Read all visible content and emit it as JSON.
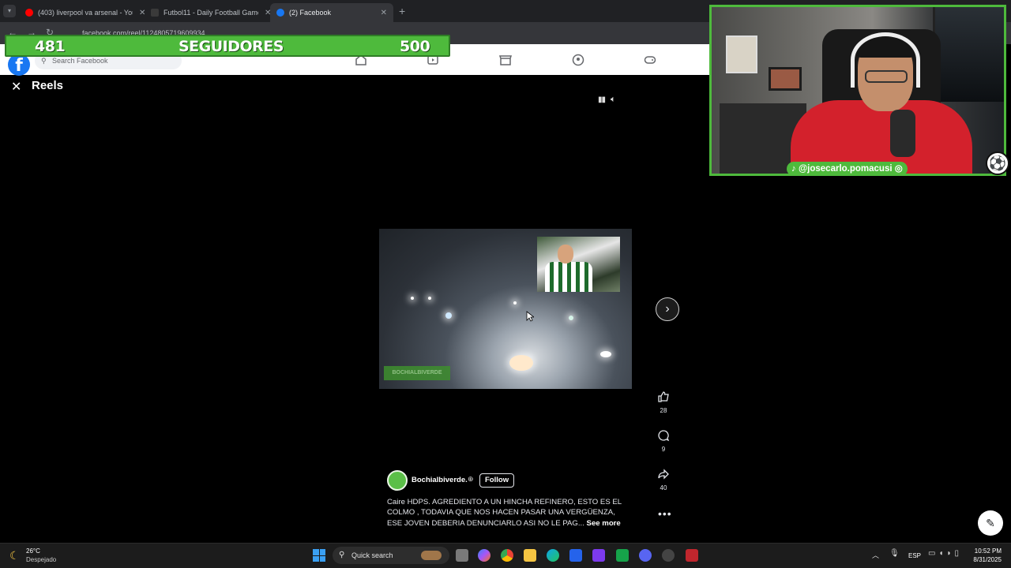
{
  "browser": {
    "tabs": [
      {
        "title": "(403) liverpool va arsenal - You",
        "favicon_color": "#ff0000"
      },
      {
        "title": "Futbol11 - Daily Football Game",
        "favicon_color": "#3a3a3a"
      },
      {
        "title": "(2) Facebook",
        "favicon_color": "#1877f2"
      }
    ],
    "new_tab": "+",
    "url": "facebook.com/reel/1124805719609934"
  },
  "banner": {
    "current": "481",
    "label": "SEGUIDORES",
    "goal": "500"
  },
  "facebook": {
    "logo": "f",
    "search_placeholder": "Search Facebook",
    "nav_icons": [
      "home-icon",
      "video-icon",
      "marketplace-icon",
      "groups-icon",
      "gaming-icon"
    ]
  },
  "reels": {
    "title": "Reels",
    "close": "✕",
    "video_watermark": "BOCHIALBIVERDE",
    "likes": "28",
    "comments": "9",
    "shares": "40",
    "author": "Bochialbiverde.",
    "follow_label": "Follow",
    "caption": "Caire HDPS. AGREDIENTO A UN HINCHA REFINERO, ESTO ES EL COLMO , TODAVIA QUE NOS HACEN PASAR UNA VERGÜENZA, ESE JOVEN DEBERIA DENUNCIARLO ASI NO LE PAG...",
    "see_more": "See more"
  },
  "webcam": {
    "handle": "@josecarlo.pomacusi"
  },
  "taskbar": {
    "weather_temp": "26°C",
    "weather_desc": "Despejado",
    "search_label": "Quick search",
    "language": "ESP",
    "time": "10:52 PM",
    "date": "8/31/2025"
  },
  "colors": {
    "accent_green": "#4eba3c",
    "facebook_blue": "#1877f2"
  }
}
